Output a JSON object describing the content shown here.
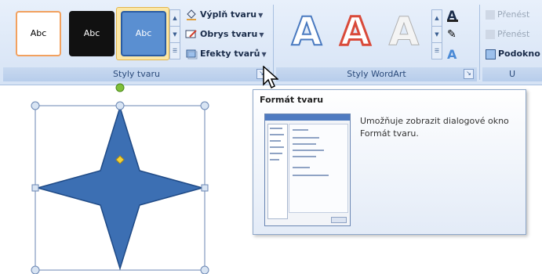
{
  "ribbon": {
    "shape_styles": {
      "caption": "Styly tvaru",
      "thumbnails": [
        {
          "label": "Abc",
          "style": "orange-outline"
        },
        {
          "label": "Abc",
          "style": "black-fill"
        },
        {
          "label": "Abc",
          "style": "blue-fill-selected"
        }
      ],
      "commands": [
        {
          "label": "Výplň tvaru",
          "icon": "paint-bucket-icon"
        },
        {
          "label": "Obrys tvaru",
          "icon": "pencil-outline-icon"
        },
        {
          "label": "Efekty tvarů",
          "icon": "shape-effects-icon"
        }
      ]
    },
    "wordart_styles": {
      "caption": "Styly WordArt",
      "samples": [
        "A",
        "A",
        "A"
      ]
    },
    "arrange": {
      "commands": [
        {
          "label": "Přenést",
          "icon": "bring-forward-icon"
        },
        {
          "label": "Přenést",
          "icon": "send-backward-icon"
        },
        {
          "label": "Podokno",
          "icon": "selection-pane-icon"
        }
      ],
      "caption": "U"
    }
  },
  "tooltip": {
    "title": "Formát tvaru",
    "description": "Umožňuje zobrazit dialogové okno Formát tvaru."
  },
  "colors": {
    "shape_fill": "#3c6fb3",
    "shape_stroke": "#1f4a86",
    "handle": "#d8e4f3",
    "adjust_handle": "#f2d33b",
    "rotate_handle": "#7fbf3a"
  }
}
